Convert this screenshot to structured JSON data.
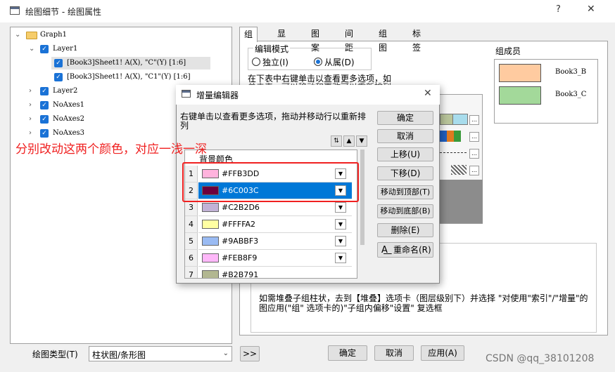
{
  "window": {
    "title": "绘图细节 - 绘图属性",
    "help": "?",
    "close": "✕"
  },
  "tree": {
    "graph": "Graph1",
    "layer1": "Layer1",
    "plot1": "[Book3]Sheet1! A(X), \"C\"(Y) [1:6]",
    "plot2": "[Book3]Sheet1! A(X), \"C1\"(Y) [1:6]",
    "layer2": "Layer2",
    "noaxes1": "NoAxes1",
    "noaxes2": "NoAxes2",
    "noaxes3": "NoAxes3"
  },
  "tabs": [
    "组",
    "显示",
    "图案",
    "间距",
    "组图",
    "标签"
  ],
  "group_panel": {
    "edit_mode_label": "编辑模式",
    "option_independent": "独立(I)",
    "option_dependent": "从属(D)",
    "selected_mode": "dependent",
    "table_hint": "在下表中右键单击以查看更多选项，如",
    "table_hint_2": "单击表，可以移动和更改可以重新排列",
    "members_label": "组成员",
    "members": [
      {
        "name": "Book3_B",
        "color": "#FFCBA0"
      },
      {
        "name": "Book3_C",
        "color": "#A3D99A"
      }
    ],
    "stack_hint": "如需堆叠子组柱状，去到【堆叠】选项卡（图层级别下）并选择 \"对使用\"索引\"/\"增量\"的图应用(\"组\" 选项卡的)\"子组内偏移\"设置\" 复选框"
  },
  "bottom": {
    "plot_type_label": "绘图类型(T)",
    "plot_type_value": "柱状图/条形图",
    "more_button": ">>",
    "ok_button": "确定",
    "cancel_button": "取消",
    "apply_button": "应用(A)"
  },
  "dialog": {
    "title": "增量编辑器",
    "close": "✕",
    "description": "右键单击以查看更多选项，拖动并移动行以重新排列",
    "column_header": "背景颜色",
    "rows": [
      {
        "n": "1",
        "hex": "#FFB3DD",
        "selected": false
      },
      {
        "n": "2",
        "hex": "#6C003C",
        "selected": true
      },
      {
        "n": "3",
        "hex": "#C2B2D6",
        "selected": false
      },
      {
        "n": "4",
        "hex": "#FFFFA2",
        "selected": false
      },
      {
        "n": "5",
        "hex": "#9ABBF3",
        "selected": false
      },
      {
        "n": "6",
        "hex": "#FEB8F9",
        "selected": false
      },
      {
        "n": "7",
        "hex": "#B2B791",
        "selected": false
      }
    ],
    "buttons": {
      "ok": "确定",
      "cancel": "取消",
      "move_up": "上移(U)",
      "move_down": "下移(D)",
      "move_top": "移动到顶部(T)",
      "move_bottom": "移动到底部(B)",
      "delete": "删除(E)",
      "rename": "重命名(R)"
    }
  },
  "annotation": "分别改动这两个颜色，对应一浅一深",
  "watermark": "CSDN @qq_38101208"
}
